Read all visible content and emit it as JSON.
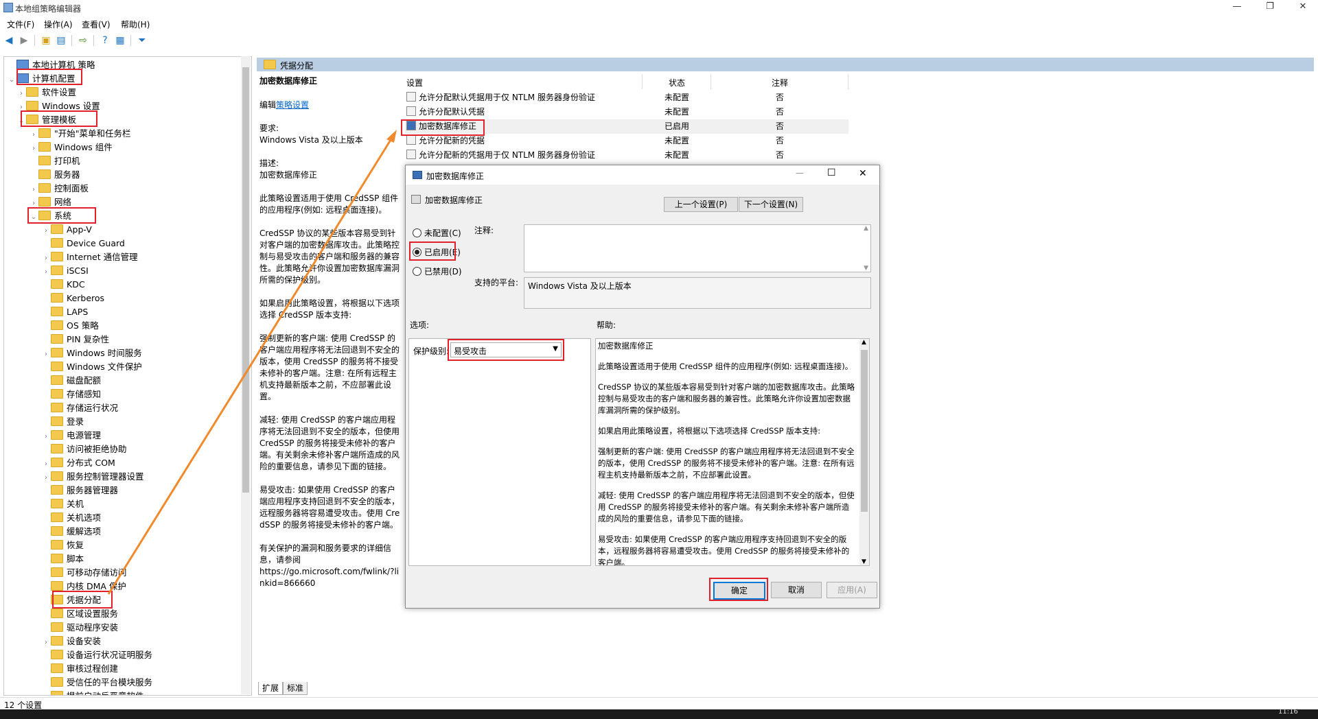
{
  "window": {
    "title": "本地组策略编辑器"
  },
  "menu": [
    "文件(F)",
    "操作(A)",
    "查看(V)",
    "帮助(H)"
  ],
  "tree": {
    "items": [
      {
        "label": "本地计算机 策略",
        "level": 0,
        "arrow": "",
        "icon": "comp"
      },
      {
        "label": "计算机配置",
        "level": 0,
        "arrow": "v",
        "icon": "comp"
      },
      {
        "label": "软件设置",
        "level": 1,
        "arrow": ">",
        "icon": "folder"
      },
      {
        "label": "Windows 设置",
        "level": 1,
        "arrow": ">",
        "icon": "folder"
      },
      {
        "label": "管理模板",
        "level": 1,
        "arrow": "v",
        "icon": "folder"
      },
      {
        "label": "\"开始\"菜单和任务栏",
        "level": 2,
        "arrow": ">",
        "icon": "folder"
      },
      {
        "label": "Windows 组件",
        "level": 2,
        "arrow": ">",
        "icon": "folder"
      },
      {
        "label": "打印机",
        "level": 2,
        "arrow": "",
        "icon": "folder"
      },
      {
        "label": "服务器",
        "level": 2,
        "arrow": "",
        "icon": "folder"
      },
      {
        "label": "控制面板",
        "level": 2,
        "arrow": ">",
        "icon": "folder"
      },
      {
        "label": "网络",
        "level": 2,
        "arrow": ">",
        "icon": "folder"
      },
      {
        "label": "系统",
        "level": 2,
        "arrow": "v",
        "icon": "folder"
      },
      {
        "label": "App-V",
        "level": 3,
        "arrow": ">",
        "icon": "folder"
      },
      {
        "label": "Device Guard",
        "level": 3,
        "arrow": "",
        "icon": "folder"
      },
      {
        "label": "Internet 通信管理",
        "level": 3,
        "arrow": ">",
        "icon": "folder"
      },
      {
        "label": "iSCSI",
        "level": 3,
        "arrow": ">",
        "icon": "folder"
      },
      {
        "label": "KDC",
        "level": 3,
        "arrow": "",
        "icon": "folder"
      },
      {
        "label": "Kerberos",
        "level": 3,
        "arrow": "",
        "icon": "folder"
      },
      {
        "label": "LAPS",
        "level": 3,
        "arrow": "",
        "icon": "folder"
      },
      {
        "label": "OS 策略",
        "level": 3,
        "arrow": "",
        "icon": "folder"
      },
      {
        "label": "PIN 复杂性",
        "level": 3,
        "arrow": "",
        "icon": "folder"
      },
      {
        "label": "Windows 时间服务",
        "level": 3,
        "arrow": ">",
        "icon": "folder"
      },
      {
        "label": "Windows 文件保护",
        "level": 3,
        "arrow": "",
        "icon": "folder"
      },
      {
        "label": "磁盘配额",
        "level": 3,
        "arrow": "",
        "icon": "folder"
      },
      {
        "label": "存储感知",
        "level": 3,
        "arrow": "",
        "icon": "folder"
      },
      {
        "label": "存储运行状况",
        "level": 3,
        "arrow": "",
        "icon": "folder"
      },
      {
        "label": "登录",
        "level": 3,
        "arrow": "",
        "icon": "folder"
      },
      {
        "label": "电源管理",
        "level": 3,
        "arrow": ">",
        "icon": "folder"
      },
      {
        "label": "访问被拒绝协助",
        "level": 3,
        "arrow": "",
        "icon": "folder"
      },
      {
        "label": "分布式 COM",
        "level": 3,
        "arrow": ">",
        "icon": "folder"
      },
      {
        "label": "服务控制管理器设置",
        "level": 3,
        "arrow": ">",
        "icon": "folder"
      },
      {
        "label": "服务器管理器",
        "level": 3,
        "arrow": "",
        "icon": "folder"
      },
      {
        "label": "关机",
        "level": 3,
        "arrow": "",
        "icon": "folder"
      },
      {
        "label": "关机选项",
        "level": 3,
        "arrow": "",
        "icon": "folder"
      },
      {
        "label": "缓解选项",
        "level": 3,
        "arrow": "",
        "icon": "folder"
      },
      {
        "label": "恢复",
        "level": 3,
        "arrow": "",
        "icon": "folder"
      },
      {
        "label": "脚本",
        "level": 3,
        "arrow": "",
        "icon": "folder"
      },
      {
        "label": "可移动存储访问",
        "level": 3,
        "arrow": "",
        "icon": "folder"
      },
      {
        "label": "内核 DMA 保护",
        "level": 3,
        "arrow": "",
        "icon": "folder"
      },
      {
        "label": "凭据分配",
        "level": 3,
        "arrow": "",
        "icon": "folder"
      },
      {
        "label": "区域设置服务",
        "level": 3,
        "arrow": "",
        "icon": "folder"
      },
      {
        "label": "驱动程序安装",
        "level": 3,
        "arrow": "",
        "icon": "folder"
      },
      {
        "label": "设备安装",
        "level": 3,
        "arrow": ">",
        "icon": "folder"
      },
      {
        "label": "设备运行状况证明服务",
        "level": 3,
        "arrow": "",
        "icon": "folder"
      },
      {
        "label": "审核过程创建",
        "level": 3,
        "arrow": "",
        "icon": "folder"
      },
      {
        "label": "受信任的平台模块服务",
        "level": 3,
        "arrow": "",
        "icon": "folder"
      },
      {
        "label": "提前启动反恶意软件",
        "level": 3,
        "arrow": "",
        "icon": "folder"
      }
    ]
  },
  "detail": {
    "header": "凭据分配",
    "policy_title": "加密数据库修正",
    "edit_prefix": "编辑",
    "edit_link": "策略设置",
    "desc": [
      "要求:\nWindows Vista 及以上版本",
      "描述:\n加密数据库修正",
      "此策略设置适用于使用 CredSSP 组件的应用程序(例如: 远程桌面连接)。",
      "CredSSP 协议的某些版本容易受到针对客户端的加密数据库攻击。此策略控制与易受攻击的客户端和服务器的兼容性。此策略允许你设置加密数据库漏洞所需的保护级别。",
      "如果启用此策略设置，将根据以下选项选择 CredSSP 版本支持:",
      "强制更新的客户端: 使用 CredSSP 的客户端应用程序将无法回退到不安全的版本，使用 CredSSP 的服务将不接受未修补的客户端。注意: 在所有远程主机支持最新版本之前，不应部署此设置。",
      "减轻: 使用 CredSSP 的客户端应用程序将无法回退到不安全的版本，但使用 CredSSP 的服务将接受未修补的客户端。有关剩余未修补客户端所造成的风险的重要信息，请参见下面的链接。",
      "易受攻击: 如果使用 CredSSP 的客户端应用程序支持回退到不安全的版本，远程服务器将容易遭受攻击。使用 CredSSP 的服务将接受未修补的客户端。",
      "有关保护的漏洞和服务要求的详细信息，请参阅\nhttps://go.microsoft.com/fwlink/?linkid=866660"
    ],
    "columns": [
      "设置",
      "状态",
      "注释"
    ],
    "rows": [
      {
        "name": "允许分配默认凭据用于仅 NTLM 服务器身份验证",
        "state": "未配置",
        "note": "否"
      },
      {
        "name": "允许分配默认凭据",
        "state": "未配置",
        "note": "否"
      },
      {
        "name": "加密数据库修正",
        "state": "已启用",
        "note": "否"
      },
      {
        "name": "允许分配新的凭据",
        "state": "未配置",
        "note": "否"
      },
      {
        "name": "允许分配新的凭据用于仅 NTLM 服务器身份验证",
        "state": "未配置",
        "note": "否"
      }
    ],
    "tabs": [
      "扩展",
      "标准"
    ]
  },
  "status": "12 个设置",
  "dialog": {
    "title": "加密数据库修正",
    "subtitle": "加密数据库修正",
    "prev_btn": "上一个设置(P)",
    "next_btn": "下一个设置(N)",
    "radio_unconfigured": "未配置(C)",
    "radio_enabled": "已启用(E)",
    "radio_disabled": "已禁用(D)",
    "comment_label": "注释:",
    "platform_label": "支持的平台:",
    "platform_value": "Windows Vista 及以上版本",
    "options_label": "选项:",
    "help_label": "帮助:",
    "protection_label": "保护级别:",
    "protection_value": "易受攻击",
    "help": [
      "加密数据库修正",
      "此策略设置适用于使用 CredSSP 组件的应用程序(例如: 远程桌面连接)。",
      "CredSSP 协议的某些版本容易受到针对客户端的加密数据库攻击。此策略控制与易受攻击的客户端和服务器的兼容性。此策略允许你设置加密数据库漏洞所需的保护级别。",
      "如果启用此策略设置，将根据以下选项选择 CredSSP 版本支持:",
      "强制更新的客户端: 使用 CredSSP 的客户端应用程序将无法回退到不安全的版本，使用 CredSSP 的服务将不接受未修补的客户端。注意: 在所有远程主机支持最新版本之前，不应部署此设置。",
      "减轻: 使用 CredSSP 的客户端应用程序将无法回退到不安全的版本，但使用 CredSSP 的服务将接受未修补的客户端。有关剩余未修补客户端所造成的风险的重要信息，请参见下面的链接。",
      "易受攻击: 如果使用 CredSSP 的客户端应用程序支持回退到不安全的版本，远程服务器将容易遭受攻击。使用 CredSSP 的服务将接受未修补的客户端。"
    ],
    "ok_btn": "确定",
    "cancel_btn": "取消",
    "apply_btn": "应用(A)"
  },
  "taskbar": {
    "clock": "11:16"
  },
  "colors": {
    "highlight_box": "#e0202a",
    "arrow": "#f08a2c",
    "header_bar": "#b9cde3",
    "link": "#0066cc"
  }
}
